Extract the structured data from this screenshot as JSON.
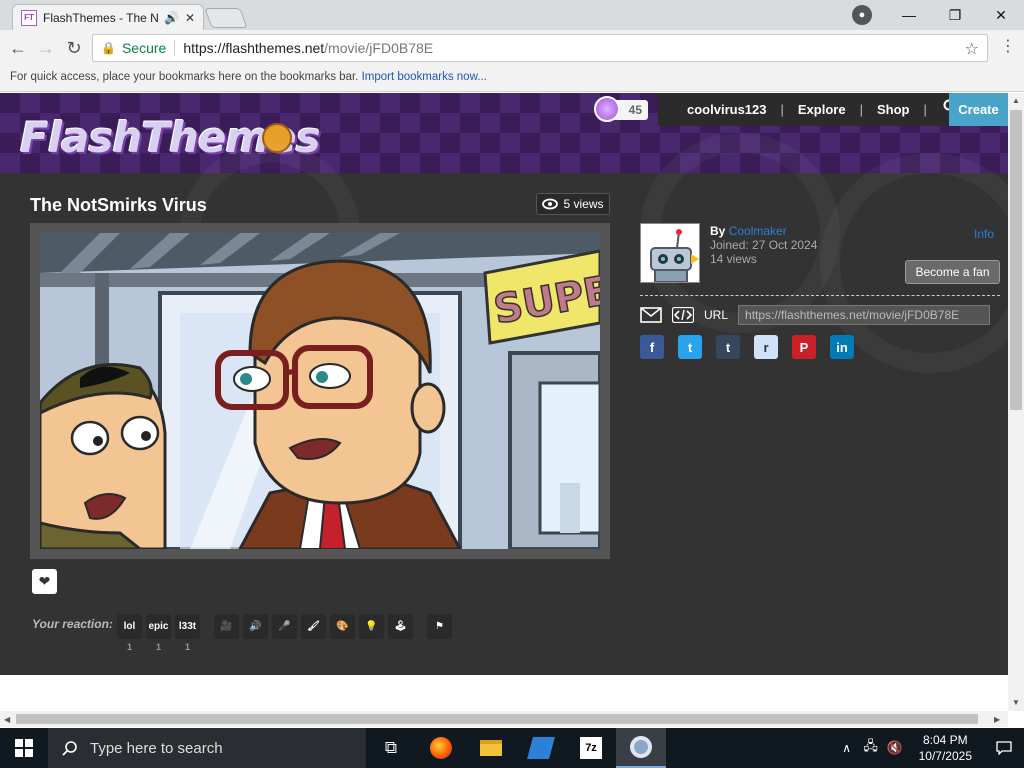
{
  "browser": {
    "tab_title": "FlashThemes - The Nc",
    "tab_favicon_text": "FT",
    "secure_label": "Secure",
    "url_host": "https://flashthemes.net",
    "url_path": "/movie/jFD0B78E",
    "bookmarks_text": "For quick access, place your bookmarks here on the bookmarks bar.",
    "bookmarks_link": "Import bookmarks now..."
  },
  "site": {
    "logo_text": "FlashThemes",
    "coins": "45",
    "nav": {
      "username": "coolvirus123",
      "explore": "Explore",
      "shop": "Shop",
      "create": "Create"
    }
  },
  "movie": {
    "title": "The NotSmirks Virus",
    "views": "5 views",
    "reaction_label": "Your reaction:",
    "reactions": [
      {
        "label": "lol",
        "count": "1"
      },
      {
        "label": "epic",
        "count": "1"
      },
      {
        "label": "l33t",
        "count": "1"
      }
    ],
    "scene_sign": "SUPE"
  },
  "author": {
    "by_label": "By",
    "name": "Coolmaker",
    "joined": "Joined: 27 Oct 2024",
    "views": "14 views",
    "info_link": "Info",
    "fan_button": "Become a fan",
    "url_label": "URL",
    "share_url": "https://flashthemes.net/movie/jFD0B78E"
  },
  "social": [
    {
      "name": "facebook",
      "glyph": "f",
      "color": "#3b5998"
    },
    {
      "name": "twitter",
      "glyph": "t",
      "color": "#2aa3ef"
    },
    {
      "name": "tumblr",
      "glyph": "t",
      "color": "#36465d"
    },
    {
      "name": "reddit",
      "glyph": "r",
      "color": "#cee3f8"
    },
    {
      "name": "pinterest",
      "glyph": "P",
      "color": "#cb2027"
    },
    {
      "name": "linkedin",
      "glyph": "in",
      "color": "#007bb6"
    }
  ],
  "taskbar": {
    "search_placeholder": "Type here to search",
    "time": "8:04 PM",
    "date": "10/7/2025"
  }
}
